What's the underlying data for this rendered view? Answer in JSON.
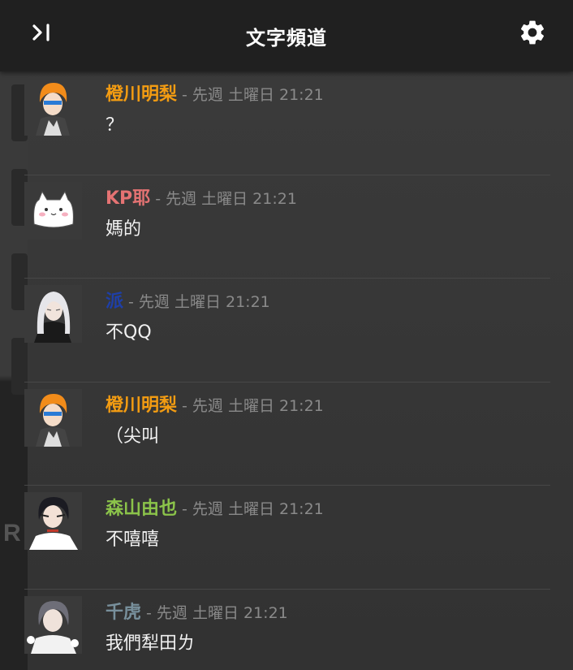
{
  "header": {
    "title": "文字頻道",
    "collapse_icon": "collapse-right-icon",
    "settings_icon": "gear-icon"
  },
  "messages": [
    {
      "username": "橙川明梨",
      "name_color": "#f39c12",
      "meta": "- 先週 土曜日 21:21",
      "text": "？",
      "avatar": "orange-hair-avatar"
    },
    {
      "username": "KP耶",
      "name_color": "#e57373",
      "meta": "- 先週 土曜日 21:21",
      "text": "媽的",
      "avatar": "white-cat-avatar"
    },
    {
      "username": "派",
      "name_color": "#1e3fa8",
      "meta": "- 先週 土曜日 21:21",
      "text": "不QQ",
      "avatar": "white-hair-avatar"
    },
    {
      "username": "橙川明梨",
      "name_color": "#f39c12",
      "meta": "- 先週 土曜日 21:21",
      "text": "（尖叫",
      "avatar": "orange-hair-avatar"
    },
    {
      "username": "森山由也",
      "name_color": "#8bc34a",
      "meta": "- 先週 土曜日 21:21",
      "text": "不嘻嘻",
      "avatar": "black-hair-avatar"
    },
    {
      "username": "千虎",
      "name_color": "#78909c",
      "meta": "- 先週 土曜日 21:21",
      "text": "我們犁田ㄌ",
      "avatar": "grey-hair-avatar"
    }
  ]
}
